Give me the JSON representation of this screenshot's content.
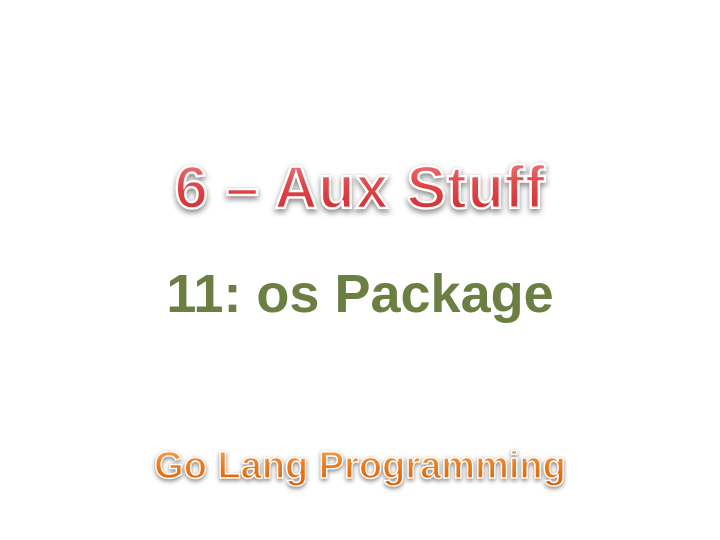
{
  "slide": {
    "title": "6 – Aux Stuff",
    "subtitle": "11: os Package",
    "footer": "Go Lang Programming"
  },
  "colors": {
    "background": "#ffffff",
    "title": "#d8393c",
    "subtitle": "#6a7f41",
    "footer": "#e46c0a"
  }
}
